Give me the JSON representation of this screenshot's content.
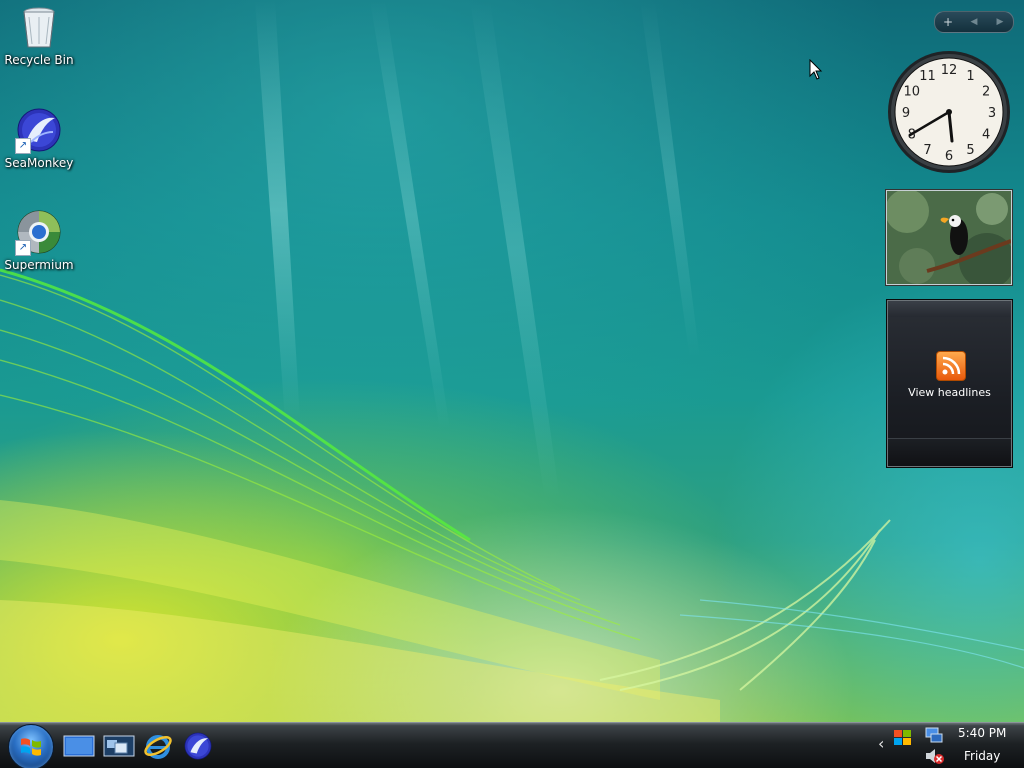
{
  "desktop": {
    "icons": [
      {
        "label": "Recycle Bin",
        "icon": "recycle-bin-icon"
      },
      {
        "label": "SeaMonkey",
        "icon": "seamonkey-icon"
      },
      {
        "label": "Supermium",
        "icon": "supermium-icon"
      }
    ]
  },
  "gadgets": {
    "toolbar": {
      "add_label": "+",
      "prev_label": "◀",
      "next_label": "▶"
    },
    "clock": {
      "numbers": [
        "12",
        "1",
        "2",
        "3",
        "4",
        "5",
        "6",
        "7",
        "8",
        "9",
        "10",
        "11"
      ],
      "time": "5:40"
    },
    "slideshow": {
      "subject": "toucan-photo"
    },
    "feed": {
      "label": "View headlines",
      "icon": "rss-icon"
    }
  },
  "taskbar": {
    "quick_launch": [
      {
        "name": "show-desktop-icon"
      },
      {
        "name": "switch-windows-icon"
      },
      {
        "name": "internet-explorer-icon"
      },
      {
        "name": "seamonkey-icon"
      }
    ],
    "tray": {
      "time": "5:40 PM",
      "day": "Friday",
      "show_hidden_label": "‹"
    }
  },
  "colors": {
    "taskbar": "#1d2124",
    "wallpaper_teal": "#138a8e",
    "wallpaper_yellow": "#e6eb28",
    "rss_orange": "#e8590c"
  }
}
